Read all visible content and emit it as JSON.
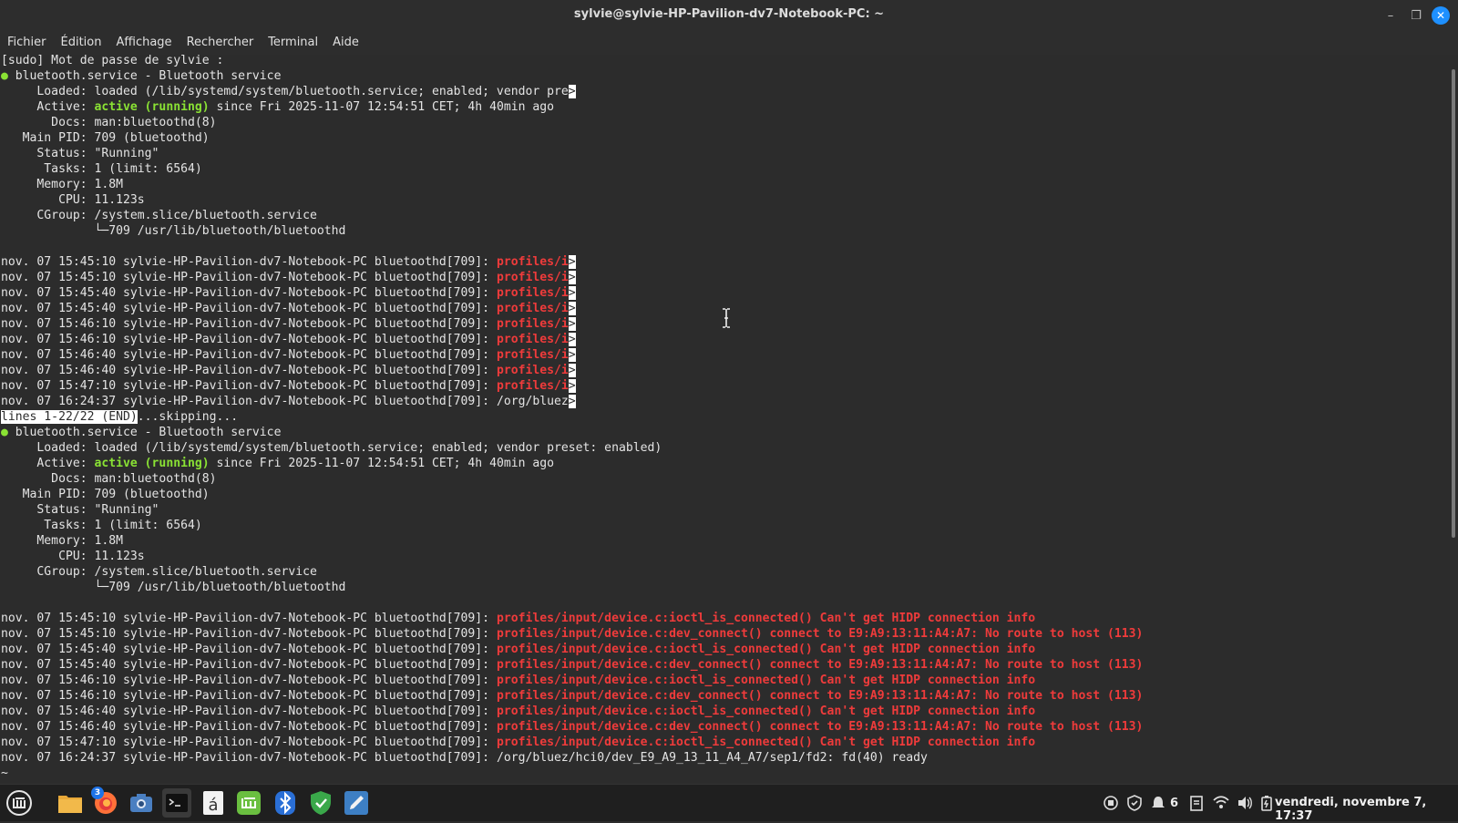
{
  "window": {
    "title": "sylvie@sylvie-HP-Pavilion-dv7-Notebook-PC: ~",
    "controls": {
      "minimize": "–",
      "maximize": "❐",
      "close": "✕"
    }
  },
  "menu": [
    "Fichier",
    "Édition",
    "Affichage",
    "Rechercher",
    "Terminal",
    "Aide"
  ],
  "terminal": {
    "sudo_prompt": "[sudo] Mot de passe de sylvie :",
    "block1": {
      "service_line": "bluetooth.service - Bluetooth service",
      "loaded": "     Loaded: loaded (/lib/systemd/system/bluetooth.service; enabled; vendor pre",
      "active_prefix": "     Active: ",
      "active_state": "active (running)",
      "active_suffix": " since Fri 2025-11-07 12:54:51 CET; 4h 40min ago",
      "docs": "       Docs: man:bluetoothd(8)",
      "mainpid": "   Main PID: 709 (bluetoothd)",
      "status": "     Status: \"Running\"",
      "tasks": "      Tasks: 1 (limit: 6564)",
      "memory": "     Memory: 1.8M",
      "cpu": "        CPU: 11.123s",
      "cgroup": "     CGroup: /system.slice/bluetooth.service",
      "cgroup_child": "             └─709 /usr/lib/bluetooth/bluetoothd",
      "logs": [
        {
          "prefix": "nov. 07 15:45:10 sylvie-HP-Pavilion-dv7-Notebook-PC bluetoothd[709]: ",
          "msg": "profiles/i",
          "error": true
        },
        {
          "prefix": "nov. 07 15:45:10 sylvie-HP-Pavilion-dv7-Notebook-PC bluetoothd[709]: ",
          "msg": "profiles/i",
          "error": true
        },
        {
          "prefix": "nov. 07 15:45:40 sylvie-HP-Pavilion-dv7-Notebook-PC bluetoothd[709]: ",
          "msg": "profiles/i",
          "error": true
        },
        {
          "prefix": "nov. 07 15:45:40 sylvie-HP-Pavilion-dv7-Notebook-PC bluetoothd[709]: ",
          "msg": "profiles/i",
          "error": true
        },
        {
          "prefix": "nov. 07 15:46:10 sylvie-HP-Pavilion-dv7-Notebook-PC bluetoothd[709]: ",
          "msg": "profiles/i",
          "error": true
        },
        {
          "prefix": "nov. 07 15:46:10 sylvie-HP-Pavilion-dv7-Notebook-PC bluetoothd[709]: ",
          "msg": "profiles/i",
          "error": true
        },
        {
          "prefix": "nov. 07 15:46:40 sylvie-HP-Pavilion-dv7-Notebook-PC bluetoothd[709]: ",
          "msg": "profiles/i",
          "error": true
        },
        {
          "prefix": "nov. 07 15:46:40 sylvie-HP-Pavilion-dv7-Notebook-PC bluetoothd[709]: ",
          "msg": "profiles/i",
          "error": true
        },
        {
          "prefix": "nov. 07 15:47:10 sylvie-HP-Pavilion-dv7-Notebook-PC bluetoothd[709]: ",
          "msg": "profiles/i",
          "error": true
        },
        {
          "prefix": "nov. 07 16:24:37 sylvie-HP-Pavilion-dv7-Notebook-PC bluetoothd[709]: ",
          "msg": "/org/bluez",
          "error": false
        }
      ],
      "truncate_marker": ">"
    },
    "pager_status": "lines 1-22/22 (END)",
    "skipping": "...skipping...",
    "block2": {
      "service_line": "bluetooth.service - Bluetooth service",
      "loaded": "     Loaded: loaded (/lib/systemd/system/bluetooth.service; enabled; vendor preset: enabled)",
      "active_prefix": "     Active: ",
      "active_state": "active (running)",
      "active_suffix": " since Fri 2025-11-07 12:54:51 CET; 4h 40min ago",
      "docs": "       Docs: man:bluetoothd(8)",
      "mainpid": "   Main PID: 709 (bluetoothd)",
      "status": "     Status: \"Running\"",
      "tasks": "      Tasks: 1 (limit: 6564)",
      "memory": "     Memory: 1.8M",
      "cpu": "        CPU: 11.123s",
      "cgroup": "     CGroup: /system.slice/bluetooth.service",
      "cgroup_child": "             └─709 /usr/lib/bluetooth/bluetoothd",
      "logs": [
        {
          "prefix": "nov. 07 15:45:10 sylvie-HP-Pavilion-dv7-Notebook-PC bluetoothd[709]: ",
          "msg": "profiles/input/device.c:ioctl_is_connected() Can't get HIDP connection info",
          "error": true
        },
        {
          "prefix": "nov. 07 15:45:10 sylvie-HP-Pavilion-dv7-Notebook-PC bluetoothd[709]: ",
          "msg": "profiles/input/device.c:dev_connect() connect to E9:A9:13:11:A4:A7: No route to host (113)",
          "error": true
        },
        {
          "prefix": "nov. 07 15:45:40 sylvie-HP-Pavilion-dv7-Notebook-PC bluetoothd[709]: ",
          "msg": "profiles/input/device.c:ioctl_is_connected() Can't get HIDP connection info",
          "error": true
        },
        {
          "prefix": "nov. 07 15:45:40 sylvie-HP-Pavilion-dv7-Notebook-PC bluetoothd[709]: ",
          "msg": "profiles/input/device.c:dev_connect() connect to E9:A9:13:11:A4:A7: No route to host (113)",
          "error": true
        },
        {
          "prefix": "nov. 07 15:46:10 sylvie-HP-Pavilion-dv7-Notebook-PC bluetoothd[709]: ",
          "msg": "profiles/input/device.c:ioctl_is_connected() Can't get HIDP connection info",
          "error": true
        },
        {
          "prefix": "nov. 07 15:46:10 sylvie-HP-Pavilion-dv7-Notebook-PC bluetoothd[709]: ",
          "msg": "profiles/input/device.c:dev_connect() connect to E9:A9:13:11:A4:A7: No route to host (113)",
          "error": true
        },
        {
          "prefix": "nov. 07 15:46:40 sylvie-HP-Pavilion-dv7-Notebook-PC bluetoothd[709]: ",
          "msg": "profiles/input/device.c:ioctl_is_connected() Can't get HIDP connection info",
          "error": true
        },
        {
          "prefix": "nov. 07 15:46:40 sylvie-HP-Pavilion-dv7-Notebook-PC bluetoothd[709]: ",
          "msg": "profiles/input/device.c:dev_connect() connect to E9:A9:13:11:A4:A7: No route to host (113)",
          "error": true
        },
        {
          "prefix": "nov. 07 15:47:10 sylvie-HP-Pavilion-dv7-Notebook-PC bluetoothd[709]: ",
          "msg": "profiles/input/device.c:ioctl_is_connected() Can't get HIDP connection info",
          "error": true
        },
        {
          "prefix": "nov. 07 16:24:37 sylvie-HP-Pavilion-dv7-Notebook-PC bluetoothd[709]: ",
          "msg": "/org/bluez/hci0/dev_E9_A9_13_11_A4_A7/sep1/fd2: fd(40) ready",
          "error": false
        }
      ]
    },
    "last_line": "~",
    "colors": {
      "background": "#2c2c2c",
      "text": "#e4e4e4",
      "active": "#8ae234",
      "error": "#ef3b3b"
    }
  },
  "taskbar": {
    "apps": [
      {
        "name": "menu-icon",
        "label": "Menu"
      },
      {
        "name": "files-icon",
        "label": "Fichiers"
      },
      {
        "name": "firefox-icon",
        "label": "Firefox",
        "badge": "3"
      },
      {
        "name": "camera-icon",
        "label": "Caméra"
      },
      {
        "name": "terminal-icon",
        "label": "Terminal"
      },
      {
        "name": "charmap-icon",
        "label": "á"
      },
      {
        "name": "mintupdate-icon",
        "label": "Mint"
      },
      {
        "name": "bluetooth-icon",
        "label": "Bluetooth"
      },
      {
        "name": "shield-icon",
        "label": "Pare-feu"
      },
      {
        "name": "text-editor-icon",
        "label": "Éditeur"
      }
    ],
    "tray_notifications": "6",
    "clock": "vendredi, novembre  7, 17:37"
  }
}
